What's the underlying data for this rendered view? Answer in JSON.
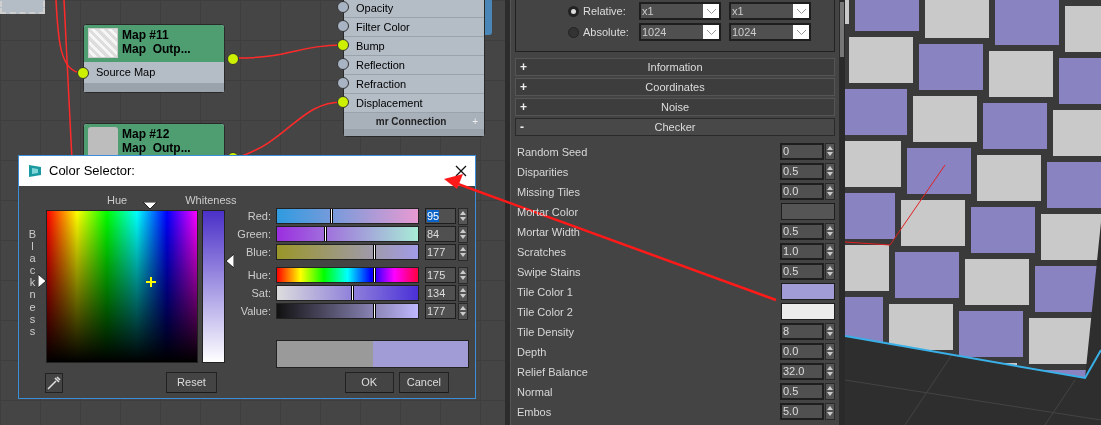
{
  "node_editor": {
    "nodes": [
      {
        "kind": "pattern",
        "title": "Map #11",
        "subtitle": "Map  Outp...",
        "slots": [
          {
            "label": "Source Map",
            "connected": true
          }
        ]
      },
      {
        "kind": "plain",
        "title": "Map #12",
        "subtitle": "Map  Outp..."
      }
    ],
    "material_node": {
      "slots": [
        {
          "label": "Opacity",
          "connected": false
        },
        {
          "label": "Filter Color",
          "connected": false
        },
        {
          "label": "Bump",
          "connected": true
        },
        {
          "label": "Reflection",
          "connected": false
        },
        {
          "label": "Refraction",
          "connected": false
        },
        {
          "label": "Displacement",
          "connected": true
        }
      ],
      "footer": "mr Connection",
      "footer_icon": "+"
    }
  },
  "properties": {
    "output_size": [
      {
        "label": "Relative:",
        "selected": true,
        "values": [
          "x1",
          "x1"
        ]
      },
      {
        "label": "Absolute:",
        "selected": false,
        "values": [
          "1024",
          "1024"
        ]
      }
    ],
    "rollouts": [
      {
        "sign": "+",
        "title": "Information",
        "expanded": false
      },
      {
        "sign": "+",
        "title": "Coordinates",
        "expanded": false
      },
      {
        "sign": "+",
        "title": "Noise",
        "expanded": false
      },
      {
        "sign": "-",
        "title": "Checker",
        "expanded": true
      }
    ],
    "parameters": [
      {
        "kind": "spinner",
        "label": "Random Seed",
        "value": "0"
      },
      {
        "kind": "spinner",
        "label": "Disparities",
        "value": "0.5"
      },
      {
        "kind": "spinner",
        "label": "Missing Tiles",
        "value": "0.0"
      },
      {
        "kind": "color",
        "label": "Mortar Color",
        "color": "#555555"
      },
      {
        "kind": "spinner",
        "label": "Mortar Width",
        "value": "0.5"
      },
      {
        "kind": "spinner",
        "label": "Scratches",
        "value": "1.0"
      },
      {
        "kind": "spinner",
        "label": "Swipe Stains",
        "value": "0.5"
      },
      {
        "kind": "color",
        "label": "Tile Color 1",
        "color": "#a29cd6"
      },
      {
        "kind": "color",
        "label": "Tile Color 2",
        "color": "#ececec"
      },
      {
        "kind": "spinner",
        "label": "Tile Density",
        "value": "8"
      },
      {
        "kind": "spinner",
        "label": "Depth",
        "value": "0.0"
      },
      {
        "kind": "spinner",
        "label": "Relief Balance",
        "value": "32.0"
      },
      {
        "kind": "spinner",
        "label": "Normal",
        "value": "0.5"
      },
      {
        "kind": "spinner",
        "label": "Embos",
        "value": "5.0"
      }
    ]
  },
  "color_selector": {
    "title": "Color Selector:",
    "hue_label": "Hue",
    "whiteness_label": "Whiteness",
    "blackness_label": "Blackness",
    "channel_groups": [
      [
        {
          "label": "Red:",
          "value": "95",
          "level": 0.38,
          "selected": true
        },
        {
          "label": "Green:",
          "value": "84",
          "level": 0.34,
          "selected": false
        },
        {
          "label": "Blue:",
          "value": "177",
          "level": 0.69,
          "selected": false
        }
      ],
      [
        {
          "label": "Hue:",
          "value": "175",
          "level": 0.69,
          "selected": false
        },
        {
          "label": "Sat:",
          "value": "134",
          "level": 0.53,
          "selected": false
        },
        {
          "label": "Value:",
          "value": "177",
          "level": 0.69,
          "selected": false
        }
      ]
    ],
    "preview_swatches": [
      {
        "color": "#9a9a9a"
      },
      {
        "color": "#a29cd6"
      }
    ],
    "buttons": [
      "Reset",
      "OK",
      "Cancel"
    ]
  }
}
